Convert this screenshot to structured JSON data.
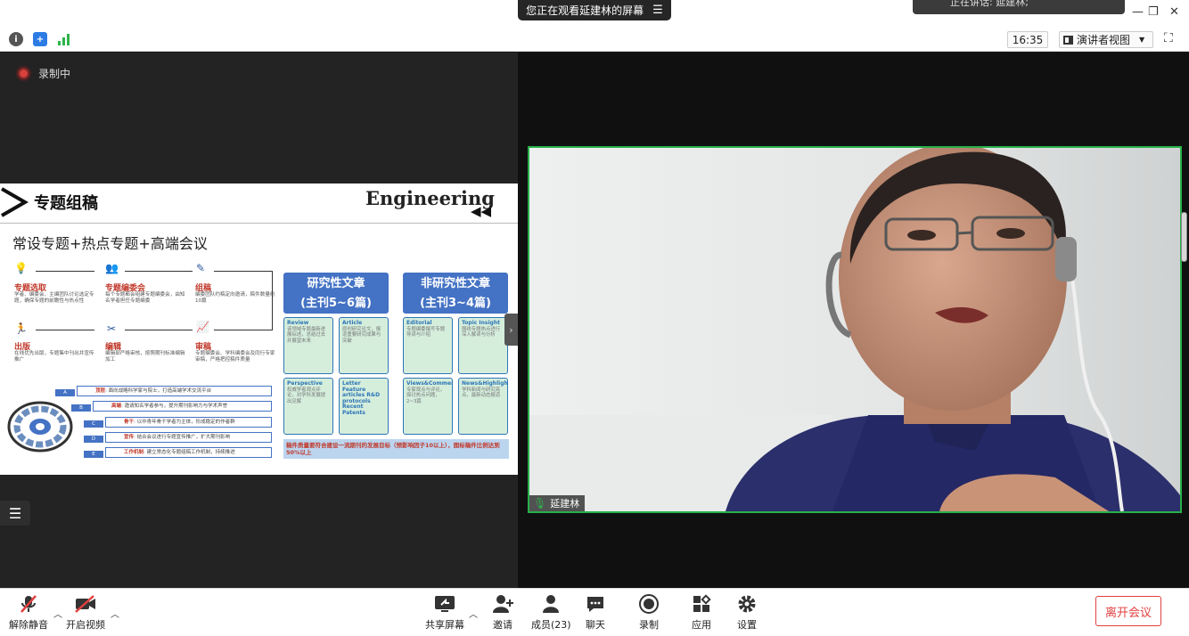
{
  "top": {
    "viewing_banner": "您正在观看延建林的屏幕",
    "speaking_label": "正在讲话: 延建林;"
  },
  "toolbar": {
    "clock": "16:35",
    "view_mode": "演讲者视图"
  },
  "share": {
    "recording_label": "录制中",
    "slide": {
      "title": "专题组稿",
      "brand": "Engineering",
      "subtitle": "常设专题+热点专题+高端会议",
      "steps": [
        {
          "heading": "专题选取",
          "text": "学者、编委会、主编团队讨论选定专题，确保专题的前瞻性与热点性"
        },
        {
          "heading": "专题编委会",
          "text": "每个专题都会组建专题编委会，由知名学者担任专题编委"
        },
        {
          "heading": "组稿",
          "text": "编委团队约稿定向邀请，稿件数量约10篇"
        },
        {
          "heading": "出版",
          "text": "在线优先出版，专题集中刊出并宣传推广"
        },
        {
          "heading": "编辑",
          "text": "编辑部严格审核，按照期刊标准编辑加工"
        },
        {
          "heading": "审稿",
          "text": "专题编委会、学科编委会及同行专家审稿，严格把控稿件质量"
        }
      ],
      "research_header": "研究性文章",
      "research_count": "(主刊5~6篇)",
      "nonresearch_header": "非研究性文章",
      "nonresearch_count": "(主刊3~4篇)",
      "research_cells": [
        {
          "label": "Review",
          "text": "该领域专题最新进展综述，总结过去并展望未来"
        },
        {
          "label": "Article",
          "text": "原创研究论文，报道重要研究成果与突破"
        },
        {
          "label": "Perspective",
          "text": "权威学者观点评论，对学科发展提出见解"
        },
        {
          "label": "Letter Feature articles R&D protocols Recent Patents",
          "text": ""
        }
      ],
      "nonresearch_cells": [
        {
          "label": "Editorial",
          "text": "专题编委撰写专题导读与介绍"
        },
        {
          "label": "Topic Insight",
          "text": "围绕专题热点进行深入解读与分析"
        },
        {
          "label": "Views&Comments",
          "text": "专家观点与评论，探讨热点问题，2~3篇"
        },
        {
          "label": "News&Highlights",
          "text": "学科新闻与研究亮点，最新动态报道"
        }
      ],
      "footer_note": "稿件质量要符合建设一流期刊的发展目标（预影响因子10以上），图标稿件比例达到50%以上",
      "layer_tags": [
        "A",
        "B",
        "C",
        "D",
        "E"
      ],
      "layers": [
        {
          "label": "顶层",
          "text": "面向战略科学家与院士，打造高端学术交流平台"
        },
        {
          "label": "高端",
          "text": "邀请知名学者参与，提升期刊影响力与学术声誉"
        },
        {
          "label": "骨干",
          "text": "以中青年骨干学者为主体，形成稳定的作者群"
        },
        {
          "label": "宣传",
          "text": "结合会议进行专题宣传推广，扩大期刊影响"
        },
        {
          "label": "工作机制",
          "text": "建立常态化专题组稿工作机制，持续推进"
        }
      ]
    }
  },
  "video": {
    "participant_name": "延建林"
  },
  "bottom": {
    "unmute": "解除静音",
    "start_video": "开启视频",
    "share_screen": "共享屏幕",
    "invite": "邀请",
    "participants": "成员(23)",
    "chat": "聊天",
    "record": "录制",
    "apps": "应用",
    "settings": "设置",
    "leave": "离开会议"
  },
  "colors": {
    "accent": "#4472c4",
    "active_speaker_border": "#27b04a",
    "leave_red": "#e04040",
    "recording_red": "#d8403a"
  }
}
